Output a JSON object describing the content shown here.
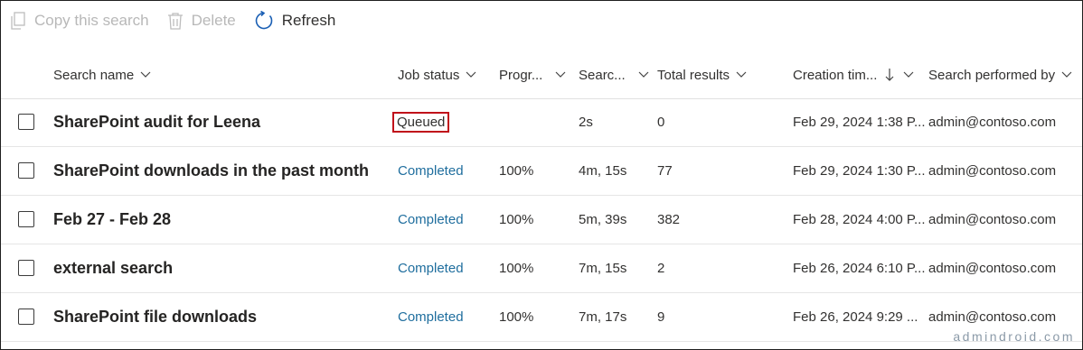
{
  "toolbar": {
    "copy_label": "Copy this search",
    "delete_label": "Delete",
    "refresh_label": "Refresh"
  },
  "columns": {
    "search_name": "Search name",
    "job_status": "Job status",
    "progress": "Progr...",
    "search_time": "Searc...",
    "total_results": "Total results",
    "creation_time": "Creation tim...",
    "performed_by": "Search performed by"
  },
  "rows": [
    {
      "name": "SharePoint audit for Leena",
      "status": "Queued",
      "progress": "",
      "duration": "2s",
      "results": "0",
      "created": "Feb 29, 2024 1:38 P...",
      "by": "admin@contoso.com"
    },
    {
      "name": "SharePoint downloads in the past month",
      "status": "Completed",
      "progress": "100%",
      "duration": "4m, 15s",
      "results": "77",
      "created": "Feb 29, 2024 1:30 P...",
      "by": "admin@contoso.com"
    },
    {
      "name": "Feb 27 - Feb 28",
      "status": "Completed",
      "progress": "100%",
      "duration": "5m, 39s",
      "results": "382",
      "created": "Feb 28, 2024 4:00 P...",
      "by": "admin@contoso.com"
    },
    {
      "name": "external search",
      "status": "Completed",
      "progress": "100%",
      "duration": "7m, 15s",
      "results": "2",
      "created": "Feb 26, 2024 6:10 P...",
      "by": "admin@contoso.com"
    },
    {
      "name": "SharePoint file downloads",
      "status": "Completed",
      "progress": "100%",
      "duration": "7m, 17s",
      "results": "9",
      "created": "Feb 26, 2024 9:29 ...",
      "by": "admin@contoso.com"
    }
  ],
  "watermark": "admindroid.com",
  "colors": {
    "link_status": "#1f6e9e",
    "highlight_border": "#c0101a",
    "refresh_icon": "#1a5fb4"
  },
  "icons": {
    "copy": "copy-icon",
    "delete": "trash-icon",
    "refresh": "refresh-icon",
    "sort": "sort-down-arrow-icon",
    "chevron": "chevron-down-icon"
  }
}
